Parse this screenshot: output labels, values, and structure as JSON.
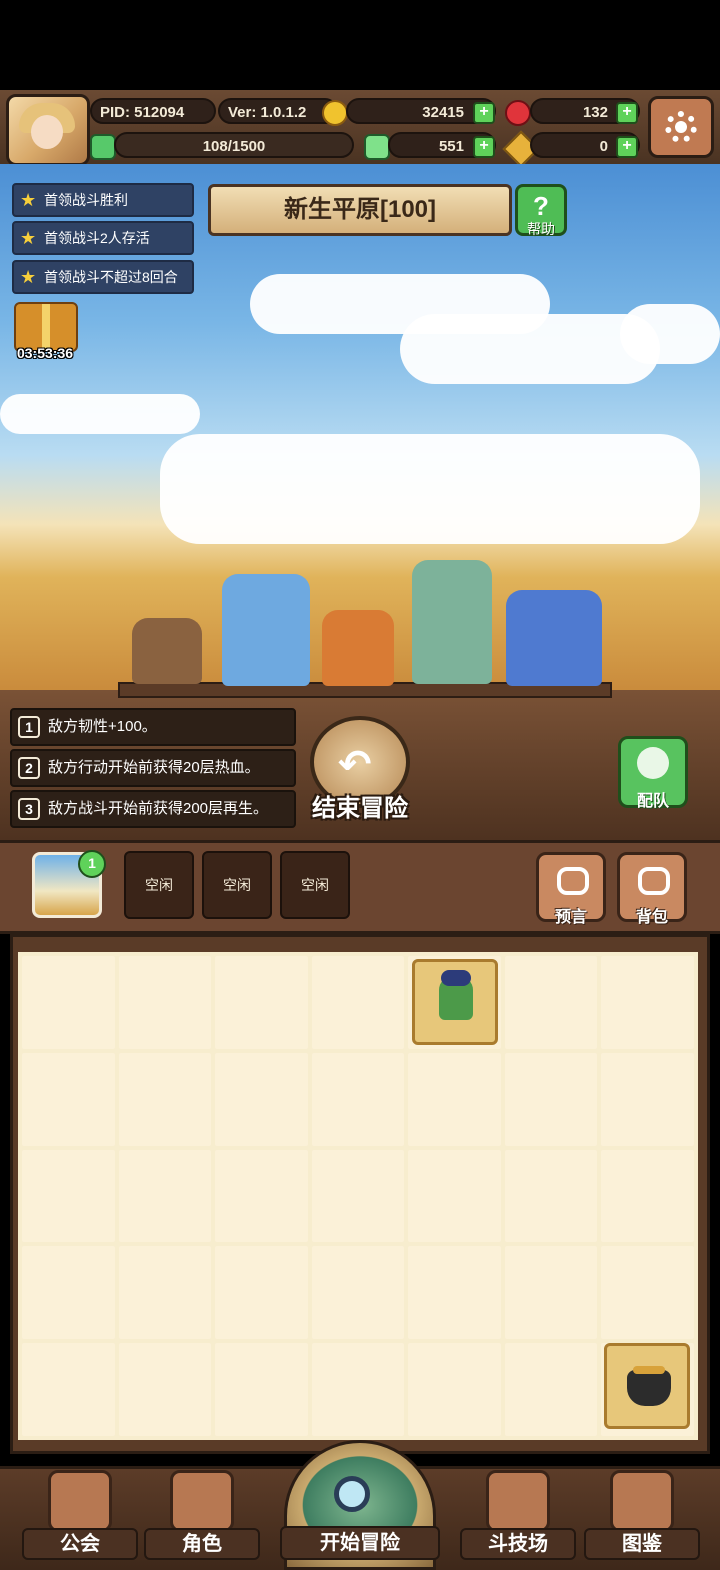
{
  "header": {
    "pid": "PID: 512094",
    "version": "Ver: 1.0.1.2",
    "gold": "32415",
    "gems": "132",
    "stamina": "108/1500",
    "clover": "551",
    "keys": "0"
  },
  "quests": [
    {
      "label": "首领战斗胜利"
    },
    {
      "label": "首领战斗2人存活"
    },
    {
      "label": "首领战斗不超过8回合"
    }
  ],
  "gift": {
    "timer": "03:53:36"
  },
  "stage": {
    "title": "新生平原[100]"
  },
  "help": {
    "label": "帮助",
    "symbol": "?"
  },
  "modifiers": [
    {
      "num": "1",
      "text": "敌方韧性+100。"
    },
    {
      "num": "2",
      "text": "敌方行动开始前获得20层热血。"
    },
    {
      "num": "3",
      "text": "敌方战斗开始前获得200层再生。"
    }
  ],
  "actions": {
    "end_adventure": "结束冒险",
    "team": "配队"
  },
  "slots": {
    "map_badge": "1",
    "idle": [
      "空闲",
      "空闲",
      "空闲"
    ],
    "prophecy": "预言",
    "bag": "背包"
  },
  "nav": {
    "guild": "公会",
    "character": "角色",
    "start": "开始冒险",
    "arena": "斗技场",
    "codex": "图鉴"
  },
  "colors": {
    "accent_green": "#5fd25a",
    "quest_bg": "#2f4264",
    "wood": "#6b4530"
  }
}
